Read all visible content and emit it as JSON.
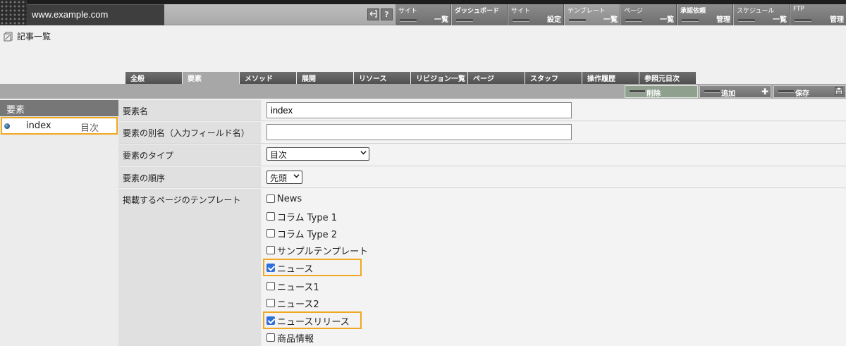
{
  "header": {
    "site_name": "www.example.com",
    "help_glyph": "?",
    "nav": [
      {
        "top": "サイト",
        "bottom": "一覧"
      },
      {
        "top": "ダッシュボード",
        "bottom": ""
      },
      {
        "top": "サイト",
        "bottom": "設定"
      },
      {
        "top": "テンプレート",
        "bottom": "一覧"
      },
      {
        "top": "ページ",
        "bottom": "一覧"
      },
      {
        "top": "承認依頼",
        "bottom": "管理"
      },
      {
        "top": "スケジュール",
        "bottom": "一覧"
      },
      {
        "top": "FTP",
        "bottom": "管理"
      }
    ]
  },
  "page": {
    "title": "記事一覧"
  },
  "tabs": [
    "全般",
    "要素",
    "メソッド",
    "展開",
    "リソース",
    "リビジョン一覧",
    "ページ",
    "スタッフ",
    "操作履歴",
    "参照元目次"
  ],
  "active_tab": "要素",
  "actions": {
    "delete": "削除",
    "add": "追加",
    "save": "保存"
  },
  "sidebar": {
    "heading": "要素",
    "item": {
      "name": "index",
      "type": "目次"
    }
  },
  "form": {
    "element_name_label": "要素名",
    "element_name_value": "index",
    "alias_label": "要素の別名（入力フィールド名）",
    "alias_value": "",
    "type_label": "要素のタイプ",
    "type_value": "目次",
    "order_label": "要素の順序",
    "order_value": "先頭",
    "templates_label": "掲載するページのテンプレート",
    "templates": [
      {
        "label": "News",
        "checked": false
      },
      {
        "label": "コラム Type 1",
        "checked": false
      },
      {
        "label": "コラム Type 2",
        "checked": false
      },
      {
        "label": "サンプルテンプレート",
        "checked": false
      },
      {
        "label": "ニュース",
        "checked": true
      },
      {
        "label": "ニュース1",
        "checked": false
      },
      {
        "label": "ニュース2",
        "checked": false
      },
      {
        "label": "ニュースリリース",
        "checked": true
      },
      {
        "label": "商品情報",
        "checked": false
      }
    ]
  },
  "colors": {
    "highlight": "#f0a822",
    "checkbox": "#2f6fdb",
    "header_bg": "#1d1d1d"
  }
}
